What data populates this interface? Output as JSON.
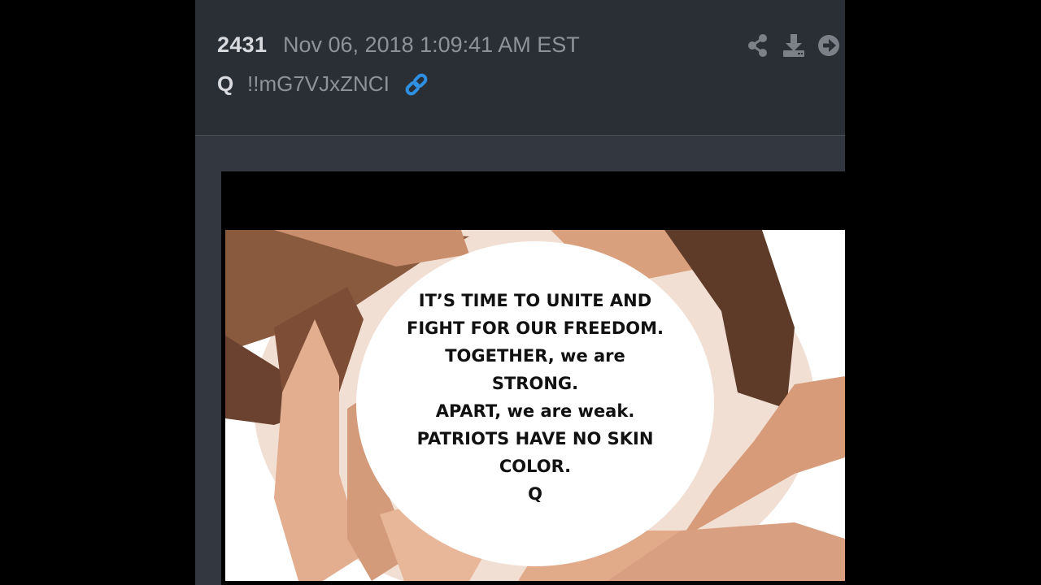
{
  "post": {
    "number": "2431",
    "timestamp": "Nov 06, 2018 1:09:41 AM EST",
    "author": "Q",
    "tripcode": "!!mG7VJxZNCI"
  },
  "icons": {
    "link": "link-icon",
    "share": "share-icon",
    "download": "download-icon",
    "next": "arrow-right-circle-icon"
  },
  "colors": {
    "background": "#000000",
    "post_body": "#333740",
    "post_header": "#2a2e35",
    "number_text": "#d8dade",
    "muted_text": "#8e939b",
    "link_accent": "#2f8fe0"
  },
  "image": {
    "lines": [
      "IT’S TIME TO UNITE AND",
      "FIGHT FOR OUR FREEDOM.",
      "TOGETHER, we are",
      "STRONG.",
      "APART, we are weak.",
      "PATRIOTS HAVE NO SKIN",
      "COLOR.",
      "Q"
    ]
  }
}
